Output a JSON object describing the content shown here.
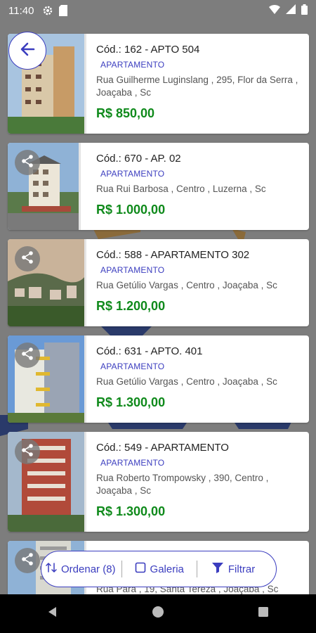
{
  "status_bar": {
    "time": "11:40"
  },
  "listings": [
    {
      "code": "Cód.: 162 - APTO 504",
      "type": "APARTAMENTO",
      "address": "Rua Guilherme Luginslang , 295, Flor da Serra , Joaçaba , Sc",
      "price": "R$  850,00"
    },
    {
      "code": "Cód.: 670 - AP. 02",
      "type": "APARTAMENTO",
      "address": "Rua Rui Barbosa , Centro , Luzerna , Sc",
      "price": "R$  1.000,00"
    },
    {
      "code": "Cód.: 588 - APARTAMENTO 302",
      "type": "APARTAMENTO",
      "address": "Rua Getúlio Vargas , Centro , Joaçaba , Sc",
      "price": "R$  1.200,00"
    },
    {
      "code": "Cód.: 631 - APTO. 401",
      "type": "APARTAMENTO",
      "address": "Rua Getúlio Vargas , Centro , Joaçaba , Sc",
      "price": "R$  1.300,00"
    },
    {
      "code": "Cód.: 549 - APARTAMENTO",
      "type": "APARTAMENTO",
      "address": "Rua Roberto Trompowsky , 390, Centro , Joaçaba , Sc",
      "price": "R$  1.300,00"
    },
    {
      "address": "Rua Pará , 19, Santa Tereza , Joaçaba , Sc"
    }
  ],
  "bottom_bar": {
    "sort_label": "Ordenar (8)",
    "gallery_label": "Galeria",
    "filter_label": "Filtrar"
  },
  "colors": {
    "accent": "#3b3dbf",
    "price": "#0f8a1b",
    "overlay": "#7d7d7d"
  }
}
